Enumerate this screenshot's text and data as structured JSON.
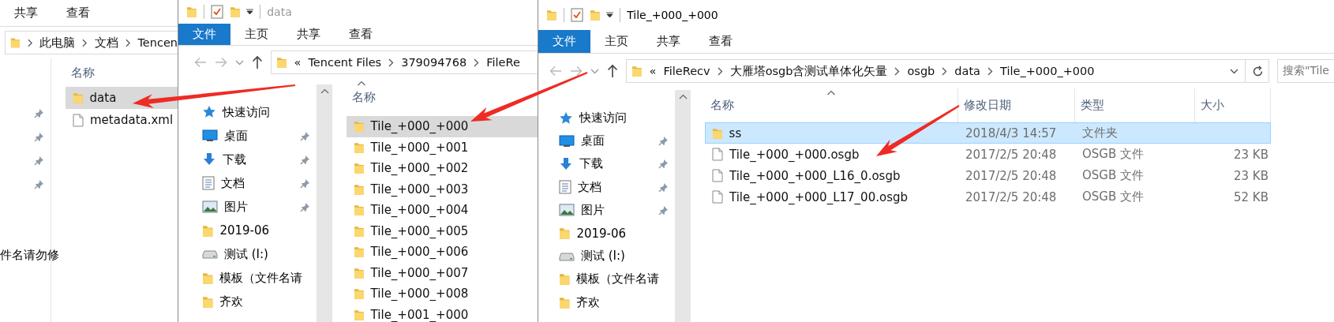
{
  "windows": [
    {
      "active": false,
      "ribbon_tabs": [
        {
          "label": "共享",
          "selected": false
        },
        {
          "label": "查看",
          "selected": false
        }
      ],
      "address": {
        "path": [
          "此电脑",
          "文档",
          "Tencen"
        ]
      },
      "nav_items": [
        {
          "kind": "blank",
          "pinned": true
        },
        {
          "kind": "blank",
          "pinned": true
        },
        {
          "kind": "blank",
          "pinned": true
        },
        {
          "kind": "blank",
          "pinned": true
        },
        {
          "kind": "blank",
          "pinned": false
        },
        {
          "kind": "blank",
          "pinned": false
        },
        {
          "kind": "blank",
          "pinned": false,
          "label": "件名请勿修"
        }
      ],
      "columns": [
        {
          "label": "名称",
          "sorted": false
        }
      ],
      "files": [
        {
          "kind": "folder",
          "name": "data",
          "selected": true
        },
        {
          "kind": "file",
          "name": "metadata.xml",
          "selected": false
        }
      ]
    },
    {
      "active": false,
      "title": "data",
      "ribbon_tabs": [
        {
          "label": "文件",
          "selected": true
        },
        {
          "label": "主页",
          "selected": false
        },
        {
          "label": "共享",
          "selected": false
        },
        {
          "label": "查看",
          "selected": false
        }
      ],
      "address": {
        "overflow": "«",
        "path": [
          "Tencent Files",
          "379094768",
          "FileRe"
        ]
      },
      "nav_items": [
        {
          "kind": "quick-access",
          "label": "快速访问",
          "pinned": false
        },
        {
          "kind": "desktop",
          "label": "桌面",
          "pinned": true
        },
        {
          "kind": "download",
          "label": "下载",
          "pinned": true
        },
        {
          "kind": "documents",
          "label": "文档",
          "pinned": true
        },
        {
          "kind": "pictures",
          "label": "图片",
          "pinned": true
        },
        {
          "kind": "folder",
          "label": "2019-06",
          "pinned": false
        },
        {
          "kind": "drive",
          "label": "测试 (I:)",
          "pinned": false
        },
        {
          "kind": "folder",
          "label": "模板（文件名请",
          "pinned": false
        },
        {
          "kind": "folder",
          "label": "齐欢",
          "pinned": false
        }
      ],
      "columns": [
        {
          "label": "名称",
          "sorted": true
        }
      ],
      "files": [
        {
          "kind": "folder",
          "name": "Tile_+000_+000",
          "selected": true
        },
        {
          "kind": "folder",
          "name": "Tile_+000_+001",
          "selected": false
        },
        {
          "kind": "folder",
          "name": "Tile_+000_+002",
          "selected": false
        },
        {
          "kind": "folder",
          "name": "Tile_+000_+003",
          "selected": false
        },
        {
          "kind": "folder",
          "name": "Tile_+000_+004",
          "selected": false
        },
        {
          "kind": "folder",
          "name": "Tile_+000_+005",
          "selected": false
        },
        {
          "kind": "folder",
          "name": "Tile_+000_+006",
          "selected": false
        },
        {
          "kind": "folder",
          "name": "Tile_+000_+007",
          "selected": false
        },
        {
          "kind": "folder",
          "name": "Tile_+000_+008",
          "selected": false
        },
        {
          "kind": "folder",
          "name": "Tile_+001_+000",
          "selected": false
        }
      ]
    },
    {
      "active": true,
      "title": "Tile_+000_+000",
      "ribbon_tabs": [
        {
          "label": "文件",
          "selected": true
        },
        {
          "label": "主页",
          "selected": false
        },
        {
          "label": "共享",
          "selected": false
        },
        {
          "label": "查看",
          "selected": false
        }
      ],
      "address": {
        "overflow": "«",
        "path": [
          "FileRecv",
          "大雁塔osgb含测试单体化矢量",
          "osgb",
          "data",
          "Tile_+000_+000"
        ]
      },
      "search": {
        "placeholder": "搜索\"Tile"
      },
      "nav_items": [
        {
          "kind": "quick-access",
          "label": "快速访问",
          "pinned": false
        },
        {
          "kind": "desktop",
          "label": "桌面",
          "pinned": true
        },
        {
          "kind": "download",
          "label": "下载",
          "pinned": true
        },
        {
          "kind": "documents",
          "label": "文档",
          "pinned": true
        },
        {
          "kind": "pictures",
          "label": "图片",
          "pinned": true
        },
        {
          "kind": "folder",
          "label": "2019-06",
          "pinned": false
        },
        {
          "kind": "drive",
          "label": "测试 (I:)",
          "pinned": false
        },
        {
          "kind": "folder",
          "label": "模板（文件名请",
          "pinned": false
        },
        {
          "kind": "folder",
          "label": "齐欢",
          "pinned": false
        }
      ],
      "columns": [
        {
          "label": "名称",
          "sorted": true
        },
        {
          "label": "修改日期",
          "sorted": false
        },
        {
          "label": "类型",
          "sorted": false
        },
        {
          "label": "大小",
          "sorted": false
        }
      ],
      "files": [
        {
          "kind": "folder",
          "name": "ss",
          "date": "2018/4/3 14:57",
          "type": "文件夹",
          "selected": true
        },
        {
          "kind": "file",
          "name": "Tile_+000_+000.osgb",
          "date": "2017/2/5 20:48",
          "type": "OSGB 文件",
          "size": "23 KB",
          "selected": false
        },
        {
          "kind": "file",
          "name": "Tile_+000_+000_L16_0.osgb",
          "date": "2017/2/5 20:48",
          "type": "OSGB 文件",
          "size": "23 KB",
          "selected": false
        },
        {
          "kind": "file",
          "name": "Tile_+000_+000_L17_00.osgb",
          "date": "2017/2/5 20:48",
          "type": "OSGB 文件",
          "size": "52 KB",
          "selected": false
        }
      ]
    }
  ]
}
